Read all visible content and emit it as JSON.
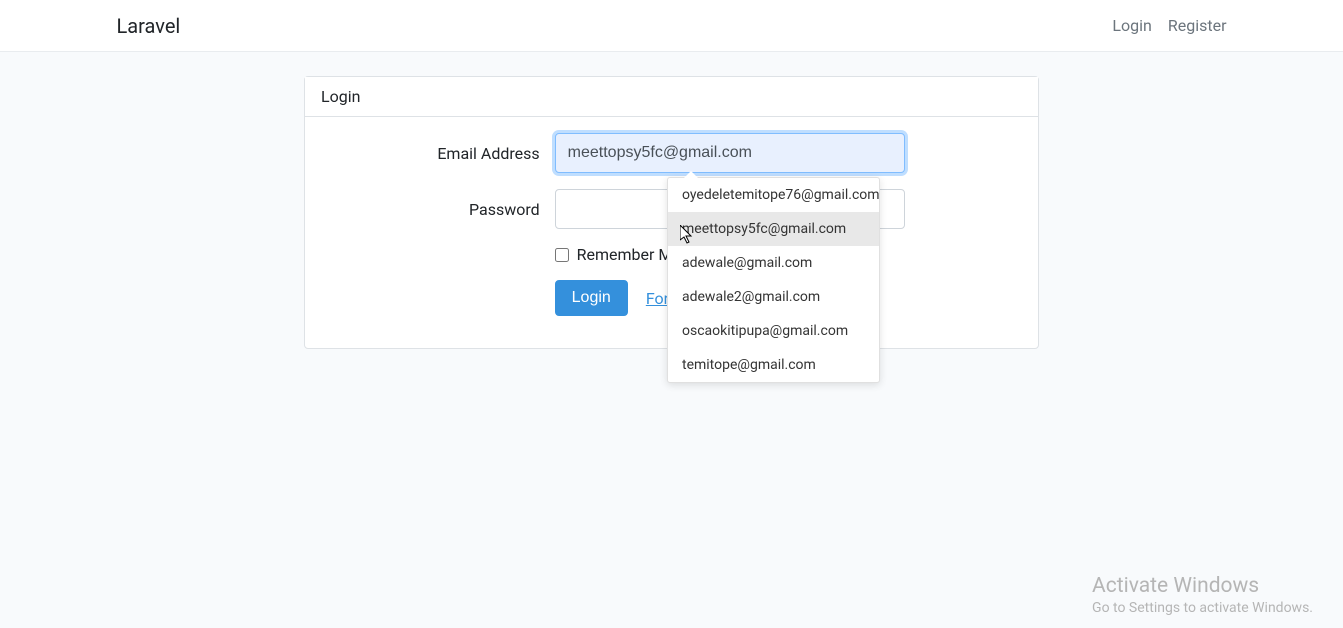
{
  "navbar": {
    "brand": "Laravel",
    "links": {
      "login": "Login",
      "register": "Register"
    }
  },
  "card": {
    "header": "Login",
    "email_label": "Email Address",
    "email_value": "meettopsy5fc@gmail.com",
    "password_label": "Password",
    "password_value": "",
    "remember_label": "Remember Me",
    "login_button": "Login",
    "forgot_link": "Forgot Your Password?"
  },
  "autocomplete": {
    "items": [
      "oyedeletemitope76@gmail.com",
      "meettopsy5fc@gmail.com",
      "adewale@gmail.com",
      "adewale2@gmail.com",
      "oscaokitipupa@gmail.com",
      "temitope@gmail.com"
    ],
    "highlighted_index": 1
  },
  "watermark": {
    "title": "Activate Windows",
    "subtitle": "Go to Settings to activate Windows."
  }
}
